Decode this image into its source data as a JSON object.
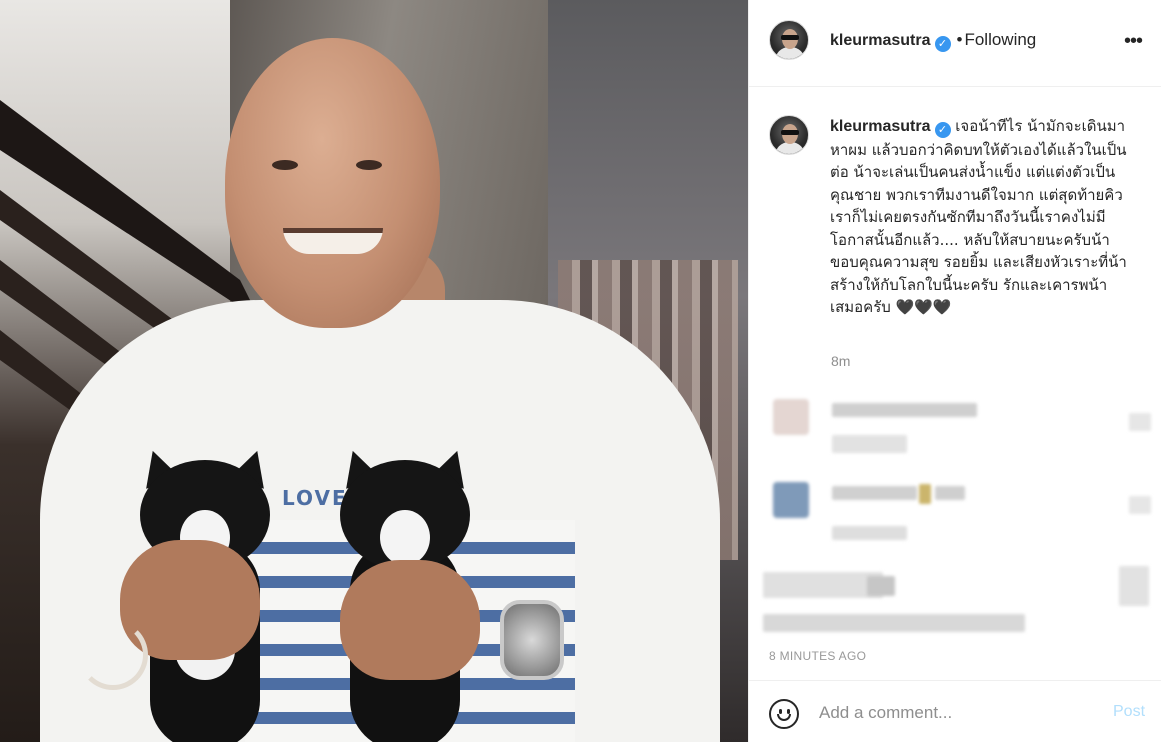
{
  "post": {
    "author": "kleurmasutra",
    "follow_dot": "•",
    "follow_status": "Following",
    "more_label": "•••",
    "caption": "เจอน้าทีไร น้ามักจะเดินมาหาผม แล้วบอกว่าคิดบทให้ตัวเองได้แล้วในเป็นต่อ น้าจะเล่นเป็นคนส่งน้ำแข็ง แต่แต่งตัวเป็นคุณชาย พวกเราทีมงานดีใจมาก แต่สุดท้ายคิวเราก็ไม่เคยตรงกันซักทีมาถึงวันนี้เราคงไม่มีโอกาสนั้นอีกแล้ว.... หลับให้สบายนะครับน้า ขอบคุณความสุข รอยยิ้ม และเสียงหัวเราะที่น้าสร้างให้กับโลกใบนี้นะครับ รักและเคารพน้าเสมอครับ 🖤🖤🖤",
    "caption_time": "8m",
    "posted_time": "8 MINUTES AGO",
    "shirt_text": "LOVE I"
  },
  "comment_box": {
    "placeholder": "Add a comment...",
    "post_label": "Post"
  },
  "icons": {
    "verified": "verified-badge-icon",
    "emoji": "emoji-smiley-icon",
    "more": "more-options-icon"
  },
  "colors": {
    "verified": "#3897f0",
    "post_disabled": "#b2dffc",
    "muted_text": "#8e8e8e"
  }
}
